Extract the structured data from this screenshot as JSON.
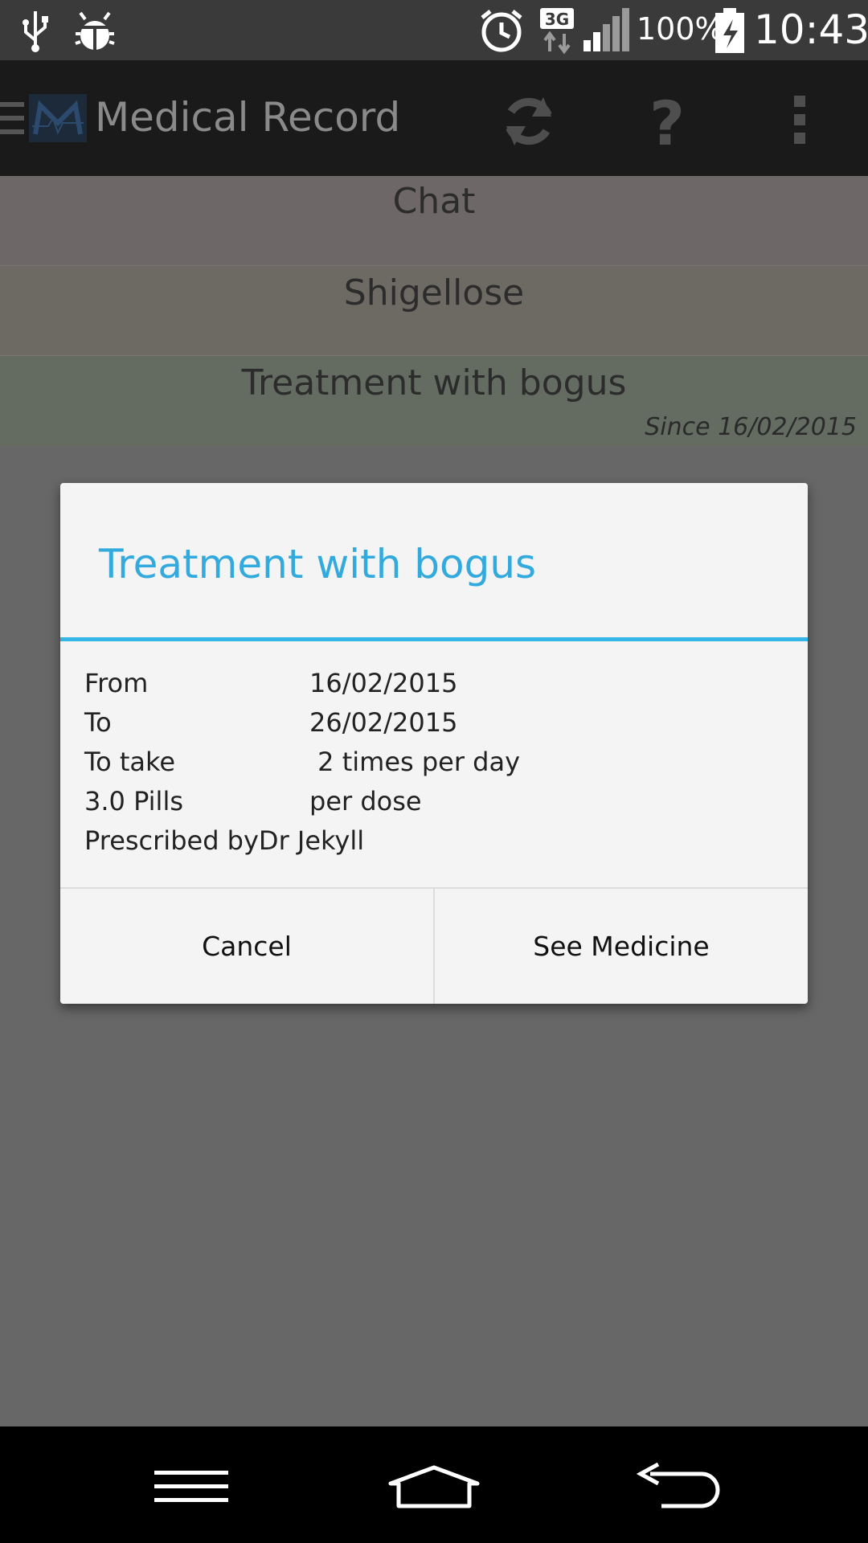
{
  "status_bar": {
    "icons": [
      "usb-icon",
      "debug-icon",
      "alarm-icon",
      "network-3g-icon",
      "signal-icon",
      "battery-charging-icon"
    ],
    "network_type": "3G",
    "battery_percent": "100%",
    "time": "10:43"
  },
  "app_bar": {
    "title": "Medical Record",
    "actions": [
      "refresh-icon",
      "help-icon",
      "overflow-menu-icon"
    ]
  },
  "list": {
    "items": [
      {
        "label": "Chat",
        "color": "#6d6767"
      },
      {
        "label": "Shigellose",
        "color": "#6c6a62"
      },
      {
        "label": "Treatment with bogus",
        "subtext": "Since 16/02/2015",
        "color": "#646c62"
      }
    ]
  },
  "dialog": {
    "title": "Treatment with bogus",
    "accent_color": "#33b5e5",
    "details": {
      "from_label": "From",
      "from_value": "16/02/2015",
      "to_label": "To",
      "to_value": "26/02/2015",
      "take_label": "To take",
      "take_value": " 2 times per day",
      "pills_label": "3.0 Pills",
      "pills_value": "per dose",
      "prescribed": "Prescribed byDr Jekyll"
    },
    "buttons": {
      "cancel": "Cancel",
      "see_medicine": "See Medicine"
    }
  },
  "nav_bar": {
    "buttons": [
      "menu-icon",
      "home-icon",
      "back-icon"
    ]
  }
}
